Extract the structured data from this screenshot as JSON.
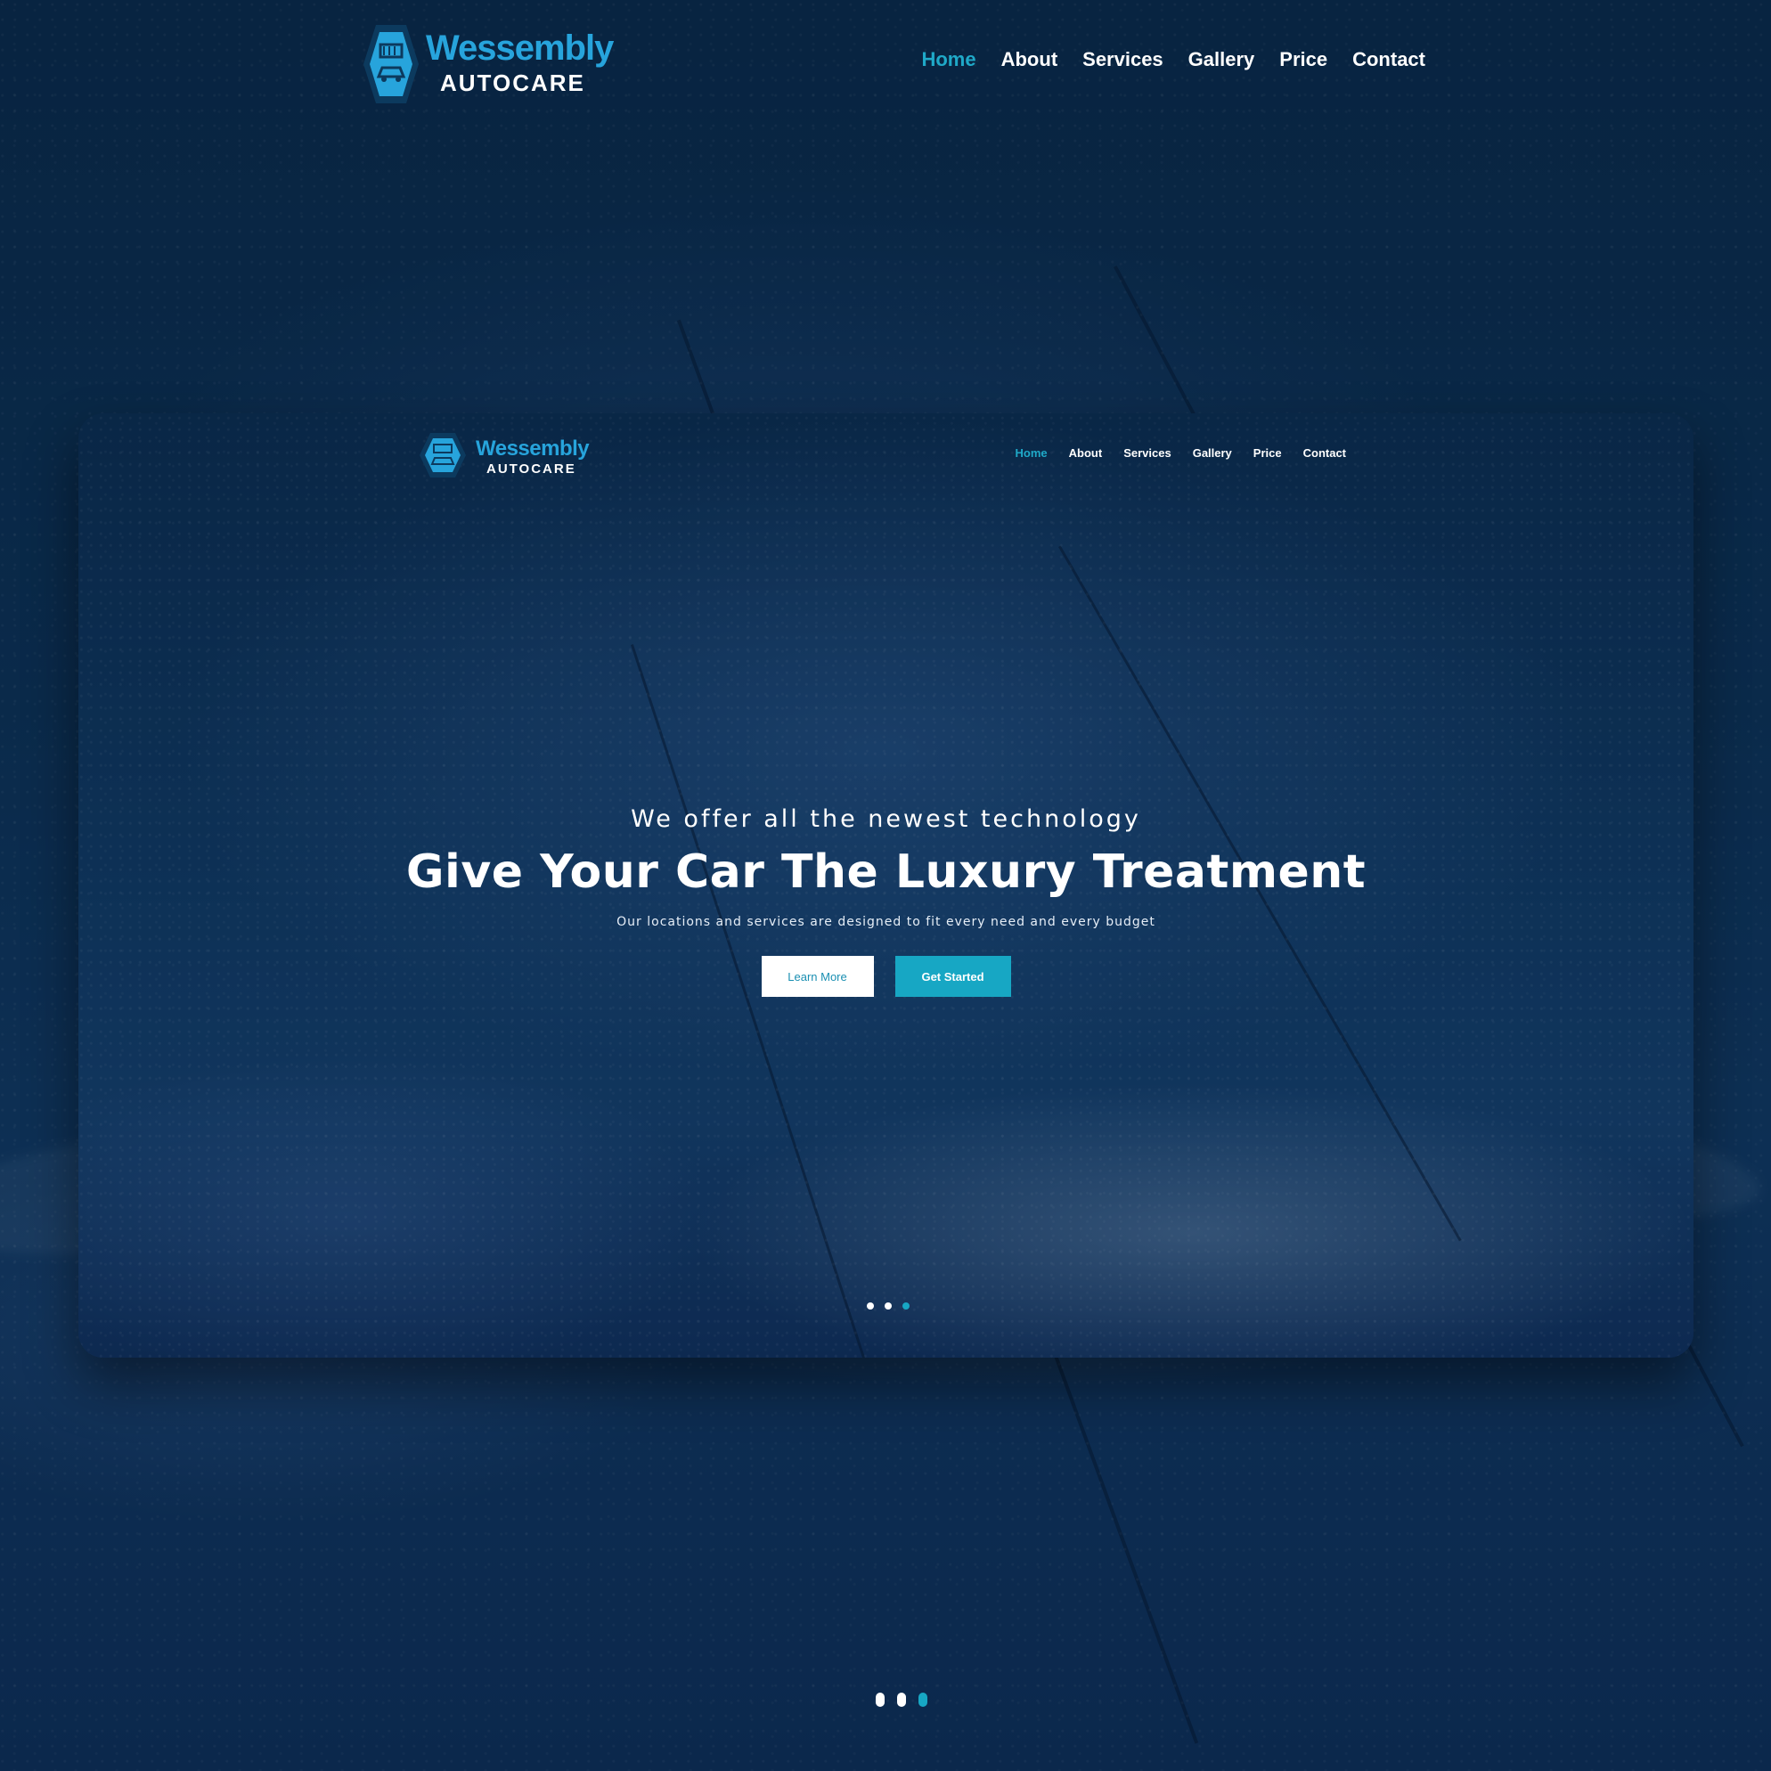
{
  "header": {
    "logo": {
      "brand": "Wessembly",
      "sub": "AUTOCARE"
    },
    "menu": [
      {
        "label": "Home",
        "active": true
      },
      {
        "label": "About",
        "active": false
      },
      {
        "label": "Services",
        "active": false
      },
      {
        "label": "Gallery",
        "active": false
      },
      {
        "label": "Price",
        "active": false
      },
      {
        "label": "Contact",
        "active": false
      }
    ]
  },
  "preview": {
    "logo": {
      "brand": "Wessembly",
      "sub": "AUTOCARE"
    },
    "menu": [
      {
        "label": "Home",
        "active": true
      },
      {
        "label": "About",
        "active": false
      },
      {
        "label": "Services",
        "active": false
      },
      {
        "label": "Gallery",
        "active": false
      },
      {
        "label": "Price",
        "active": false
      },
      {
        "label": "Contact",
        "active": false
      }
    ],
    "hero": {
      "kicker": "We offer all the newest technology",
      "title": "Give Your Car The Luxury Treatment",
      "description": "Our locations and services are designed to fit every need and every budget",
      "primary_button": "Learn More",
      "secondary_button": "Get Started"
    },
    "slider": {
      "count": 3,
      "active_index": 2
    }
  },
  "slider": {
    "count": 3,
    "active_index": 2
  },
  "colors": {
    "accent": "#17a7c4",
    "logo_blue": "#27a4dc",
    "background": "#0b2a4a"
  },
  "icons": {
    "logo": "car-wash-hexagon-icon"
  }
}
